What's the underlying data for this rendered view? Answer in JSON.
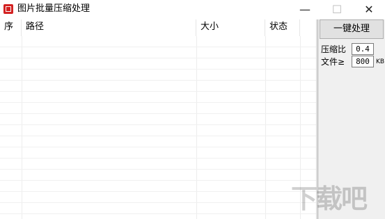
{
  "window": {
    "title": "图片批量压缩处理",
    "min_glyph": "—",
    "max_glyph": "☐",
    "close_glyph": "✕"
  },
  "table": {
    "columns": [
      "序",
      "路径",
      "大小",
      "状态"
    ]
  },
  "panel": {
    "action_button": "一键处理",
    "ratio_label": "压缩比",
    "ratio_value": "0.4",
    "file_label": "文件≥",
    "file_value": "800",
    "file_unit": "KB"
  },
  "watermark": {
    "text": "下载吧"
  }
}
